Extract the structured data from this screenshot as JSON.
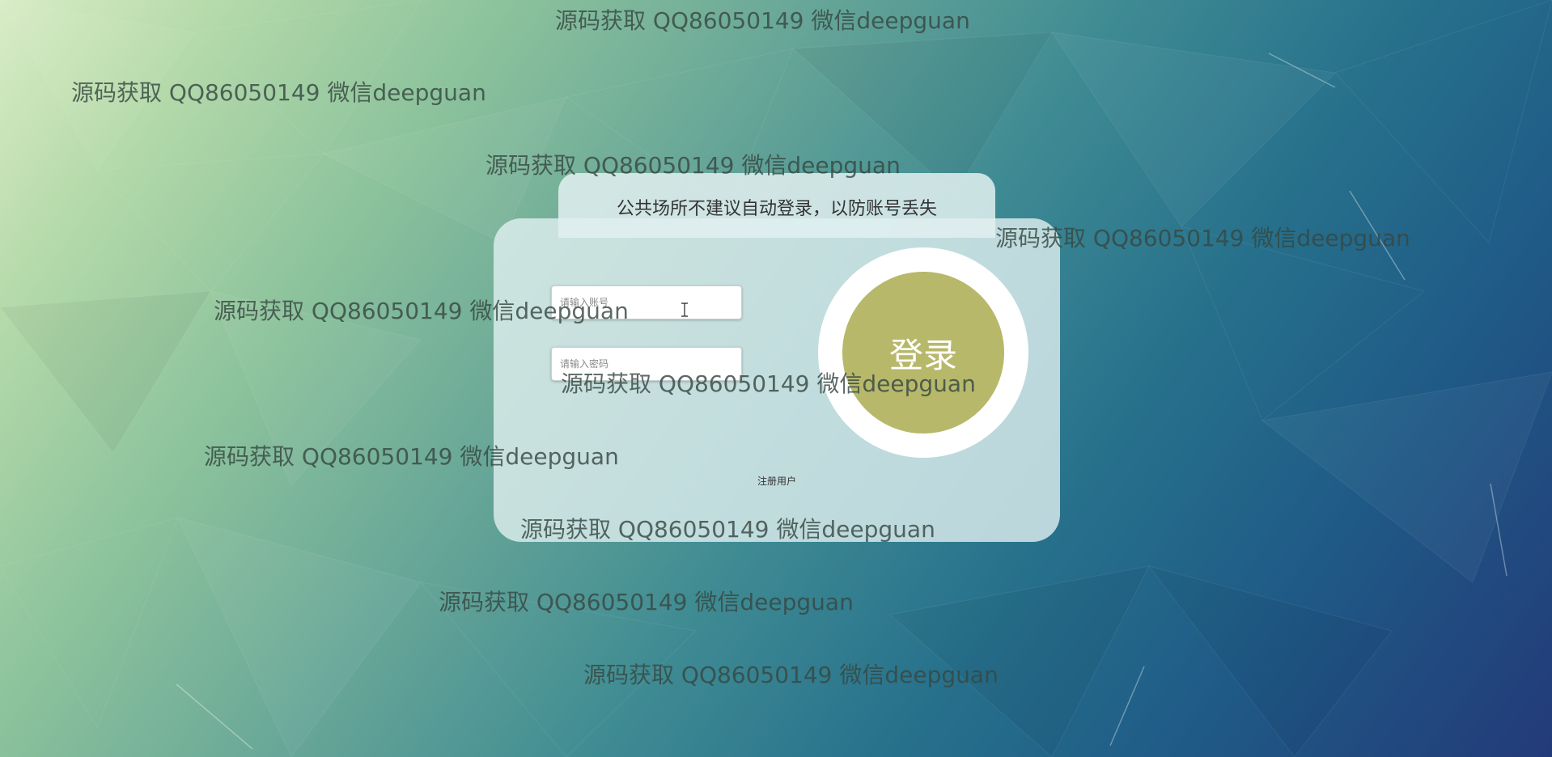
{
  "background": {
    "theme_colors": [
      "#d9ecc6",
      "#8dc39c",
      "#3f8b93",
      "#1f5a86",
      "#233a79"
    ]
  },
  "watermark_text": "源码获取 QQ86050149 微信deepguan",
  "login": {
    "tip": "公共场所不建议自动登录，以防账号丢失",
    "account_placeholder": "请输入账号",
    "password_placeholder": "请输入密码",
    "login_button": "登录",
    "register_link": "注册用户"
  },
  "colors": {
    "login_button": "#b7b86a",
    "card": "#e1f0f0"
  },
  "icons": {
    "cursor": "text-cursor-icon"
  }
}
